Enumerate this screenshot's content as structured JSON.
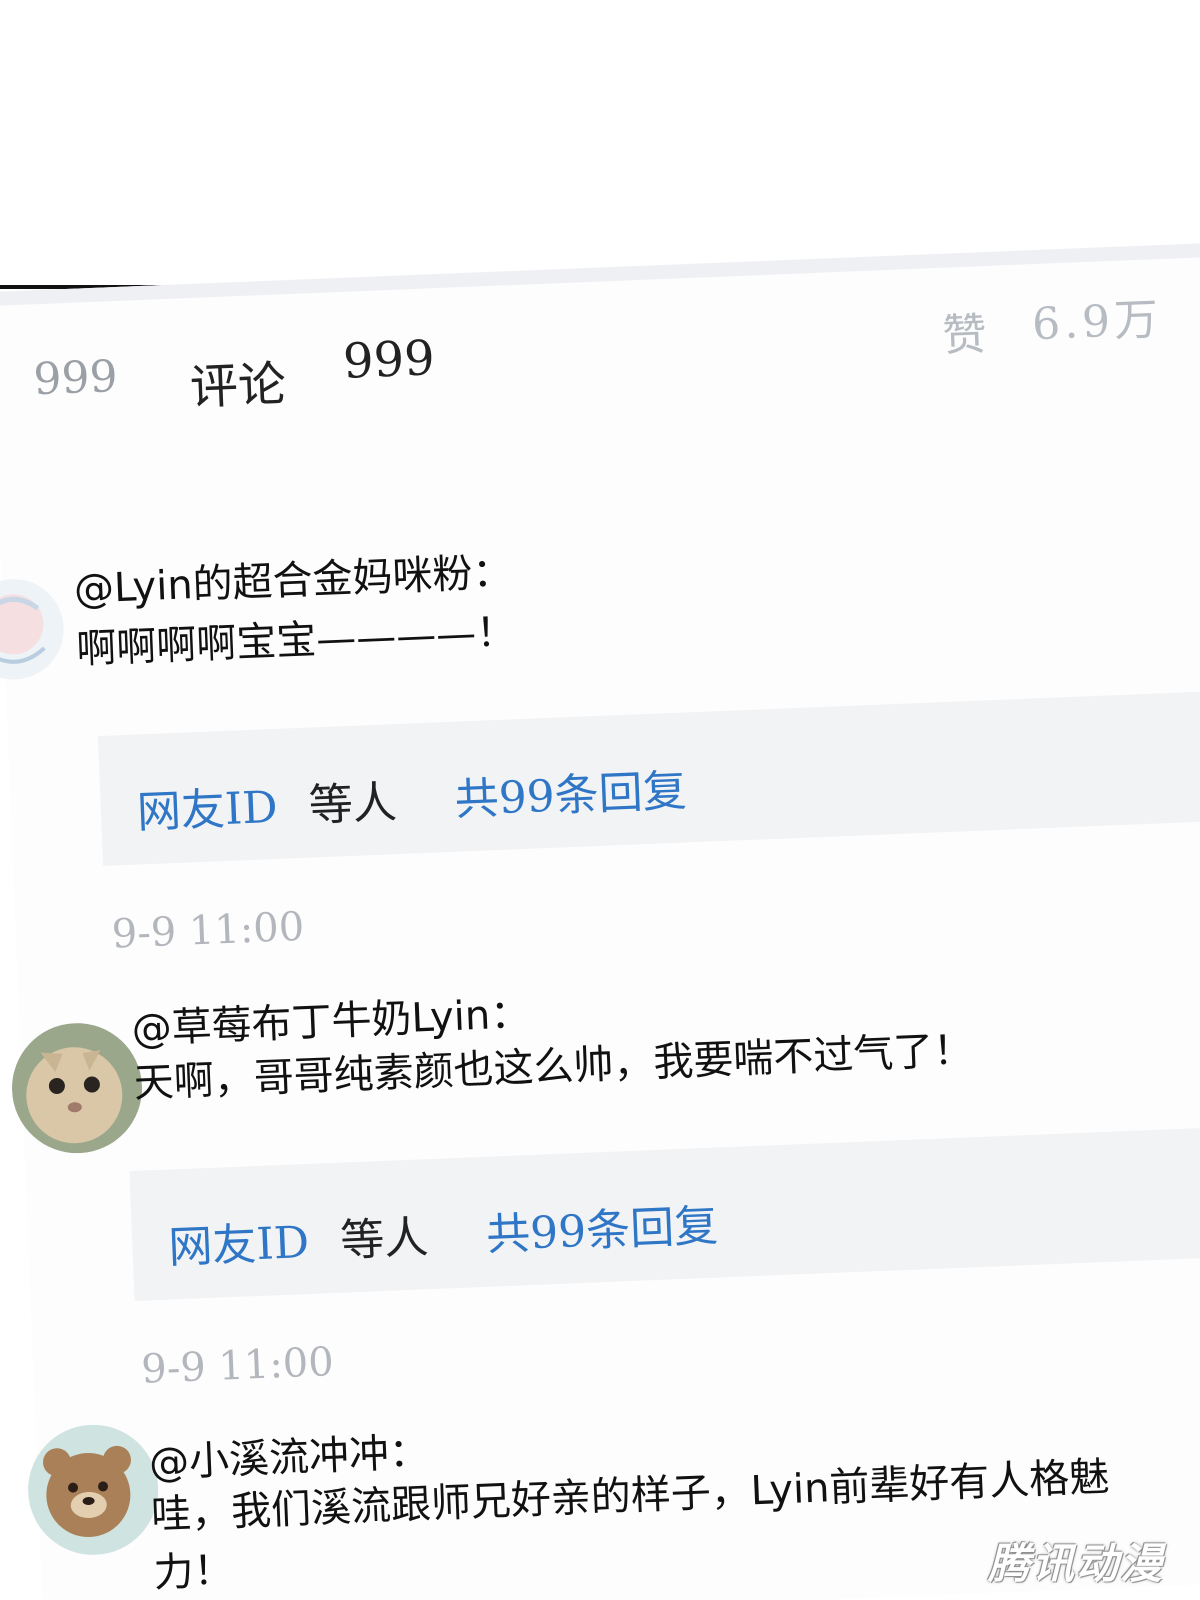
{
  "stats": {
    "count_left": "999",
    "tab_label": "评论",
    "tab_count": "999",
    "likes_label": "赞",
    "likes_count": "6.9万"
  },
  "comments": [
    {
      "user": "@Lyin的超合金妈咪粉：",
      "text": "啊啊啊啊宝宝————！",
      "reply_name": "网友ID",
      "reply_etc": "等人",
      "reply_total": "共99条回复",
      "time": "9-9 11:00"
    },
    {
      "user": "@草莓布丁牛奶Lyin：",
      "text": "天啊，哥哥纯素颜也这么帅，我要喘不过气了！",
      "reply_name": "网友ID",
      "reply_etc": "等人",
      "reply_total": "共99条回复",
      "time": "9-9 11:00"
    },
    {
      "user": "@小溪流冲冲：",
      "text": "哇，我们溪流跟师兄好亲的样子，Lyin前辈好有人格魅力！"
    }
  ],
  "watermark": "腾讯动漫"
}
